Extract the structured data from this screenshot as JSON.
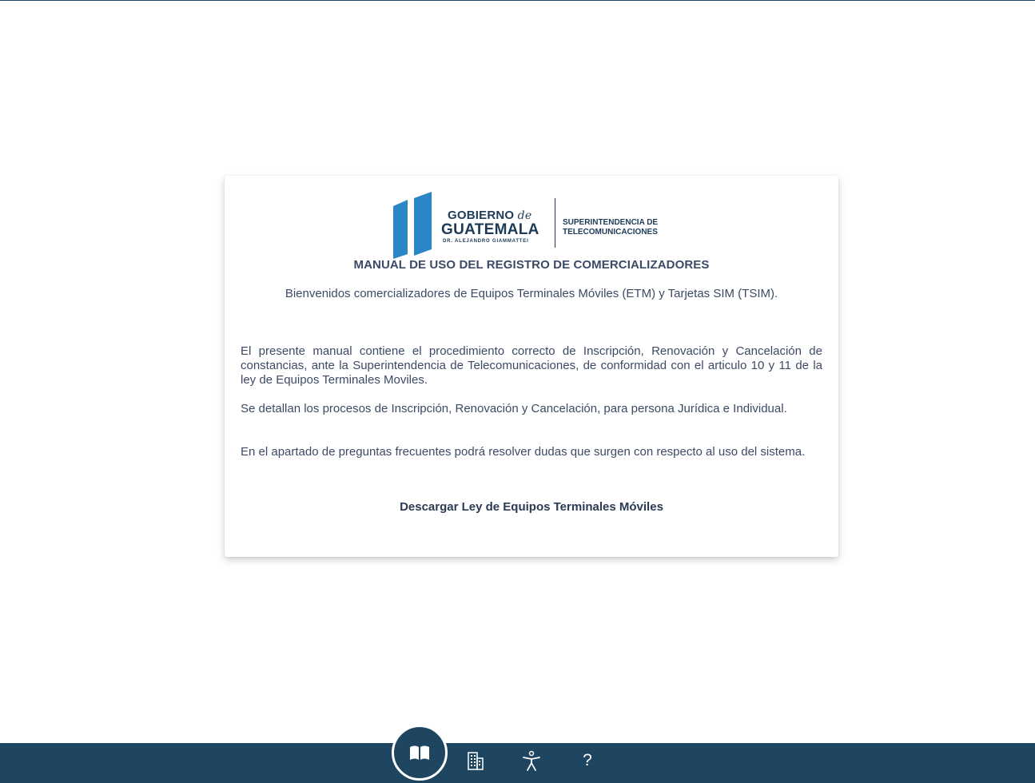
{
  "logo": {
    "gobierno": "GOBIERNO",
    "de": "de",
    "guatemala": "GUATEMALA",
    "president": "DR. ALEJANDRO GIAMMATTEI",
    "agency_line1": "SUPERINTENDENCIA DE",
    "agency_line2": "TELECOMUNICACIONES"
  },
  "main": {
    "title": "MANUAL DE USO DEL REGISTRO DE COMERCIALIZADORES",
    "welcome": "Bienvenidos comercializadores de Equipos Terminales Móviles (ETM) y Tarjetas SIM (TSIM).",
    "paragraphs": [
      "El presente manual contiene el procedimiento correcto de Inscripción, Renovación y Cancelación de constancias, ante la Superintendencia de Telecomunicaciones, de conformidad con el articulo 10 y 11 de la ley de Equipos Terminales Moviles.",
      "Se detallan los procesos de Inscripción, Renovación y Cancelación, para persona Jurídica e Individual.",
      "En el apartado de preguntas frecuentes podrá resolver dudas que surgen con respecto al uso del sistema."
    ],
    "download_link": "Descargar Ley de Equipos Terminales Móviles"
  },
  "bottom_nav": {
    "items": [
      {
        "icon": "book-open-icon",
        "active": true
      },
      {
        "icon": "building-icon",
        "active": false
      },
      {
        "icon": "accessibility-icon",
        "active": false
      },
      {
        "icon": "help-icon",
        "label": "?",
        "active": false
      }
    ]
  },
  "colors": {
    "brand_navy": "#1e4660",
    "logo_blue": "#2b86c5",
    "text": "#3d4a66"
  }
}
